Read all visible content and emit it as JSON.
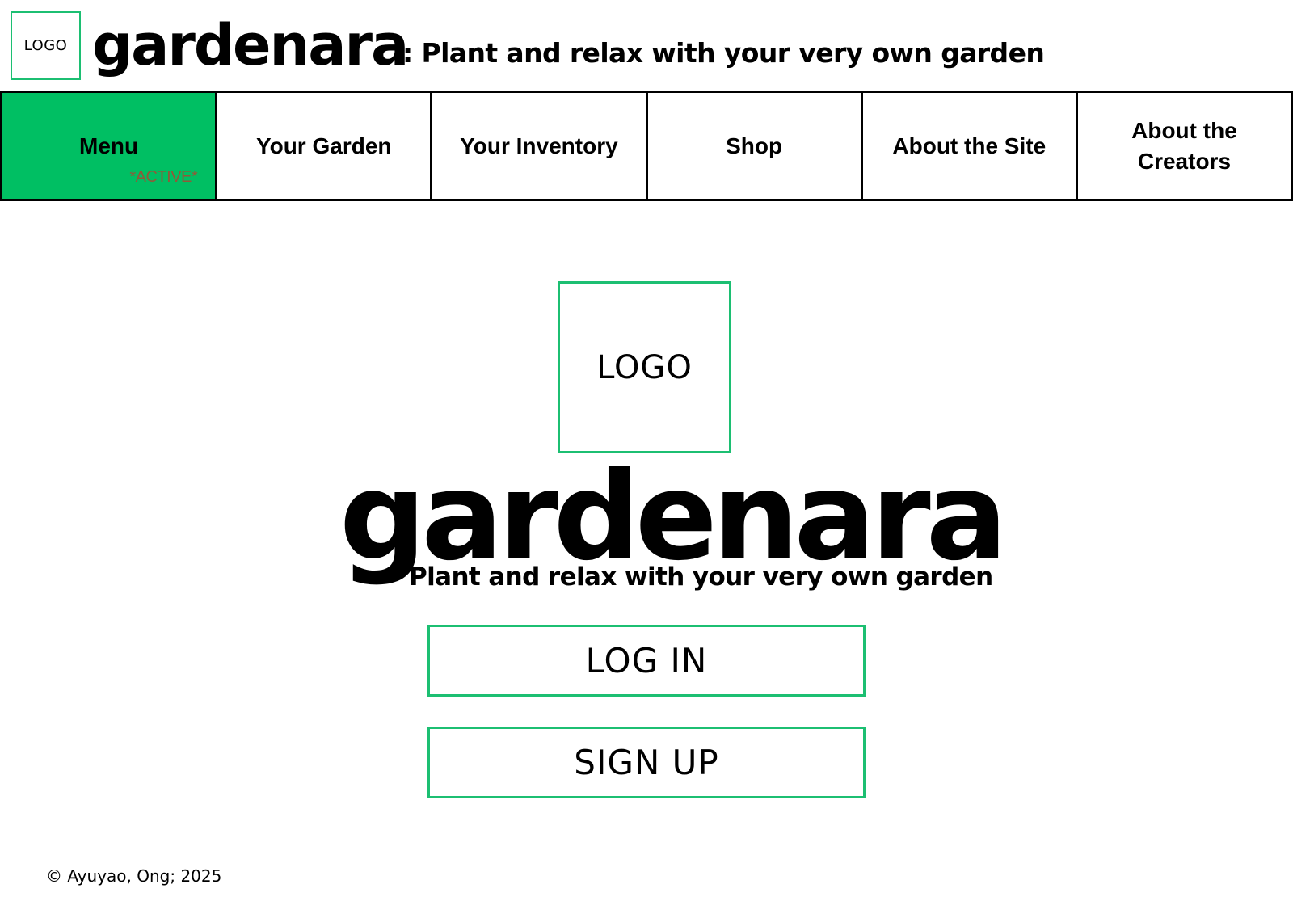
{
  "header": {
    "logo_text": "LOGO",
    "app_name": "gardenara",
    "tagline": ": Plant and relax with your very own garden"
  },
  "nav": {
    "items": [
      {
        "label": "Menu",
        "active": true,
        "active_note": "*ACTIVE*"
      },
      {
        "label": "Your Garden",
        "active": false
      },
      {
        "label": "Your Inventory",
        "active": false
      },
      {
        "label": "Shop",
        "active": false
      },
      {
        "label": "About the Site",
        "active": false
      },
      {
        "label": "About the Creators",
        "active": false
      }
    ]
  },
  "hero": {
    "logo_text": "LOGO",
    "title": "gardenara",
    "tagline": "Plant and relax with your very own garden"
  },
  "actions": {
    "login_label": "LOG IN",
    "signup_label": "SIGN UP"
  },
  "footer": {
    "copyright": "© Ayuyao, Ong; 2025"
  },
  "colors": {
    "accent_green": "#00bf63",
    "outline_green": "#1cbf72",
    "active_note": "#c0392b",
    "text": "#000000",
    "background": "#ffffff"
  }
}
